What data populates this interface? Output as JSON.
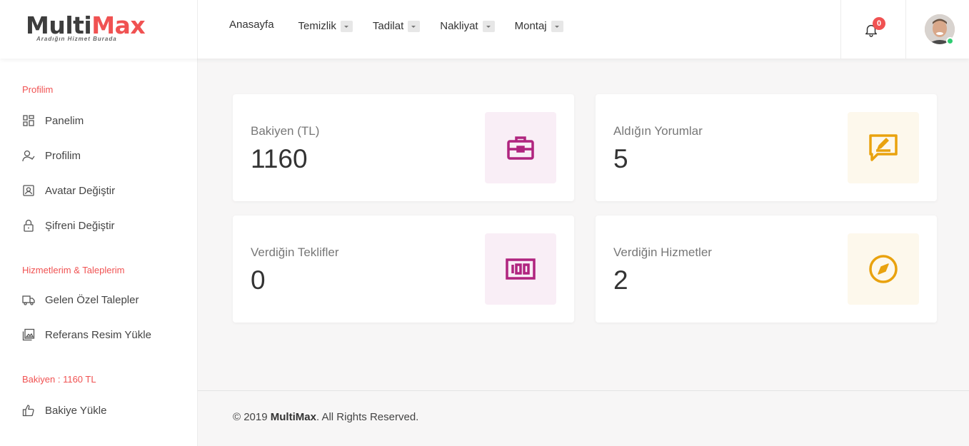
{
  "header": {
    "logo": {
      "part1": "Multi",
      "part2": "Max",
      "tagline": "Aradığın Hizmet Burada"
    },
    "nav": [
      {
        "label": "Anasayfa"
      },
      {
        "label": "Temizlik"
      },
      {
        "label": "Tadilat"
      },
      {
        "label": "Nakliyat"
      },
      {
        "label": "Montaj"
      }
    ],
    "notifications": {
      "count": "0",
      "icon": "bell-icon"
    },
    "user": {
      "icon": "avatar",
      "status_color": "#2ecc71"
    }
  },
  "sidebar": {
    "sections": [
      {
        "title": "Profilim",
        "items": [
          {
            "label": "Panelim",
            "icon": "dashboard-icon"
          },
          {
            "label": "Profilim",
            "icon": "user-check-icon"
          },
          {
            "label": "Avatar Değiştir",
            "icon": "portrait-icon"
          },
          {
            "label": "Şifreni Değiştir",
            "icon": "lock-icon"
          }
        ]
      },
      {
        "title": "Hizmetlerim & Taleplerim",
        "items": [
          {
            "label": "Gelen Özel Talepler",
            "icon": "truck-icon"
          },
          {
            "label": "Referans Resim Yükle",
            "icon": "image-icon"
          }
        ]
      },
      {
        "title": "Bakiyen : 1160 TL",
        "items": [
          {
            "label": "Bakiye Yükle",
            "icon": "thumbs-up-icon"
          }
        ]
      }
    ]
  },
  "cards": [
    {
      "label": "Bakiyen (TL)",
      "value": "1160",
      "icon": "briefcase-icon",
      "color": "#b0247f"
    },
    {
      "label": "Aldığın Yorumlar",
      "value": "5",
      "icon": "comment-edit-icon",
      "color": "#e9a20e"
    },
    {
      "label": "Verdiğin Teklifler",
      "value": "0",
      "icon": "hundred-icon",
      "color": "#b0247f"
    },
    {
      "label": "Verdiğin Hizmetler",
      "value": "2",
      "icon": "compass-icon",
      "color": "#e9a20e"
    }
  ],
  "footer": {
    "prefix": "© 2019 ",
    "brand": "MultiMax",
    "suffix": ". All Rights Reserved."
  }
}
